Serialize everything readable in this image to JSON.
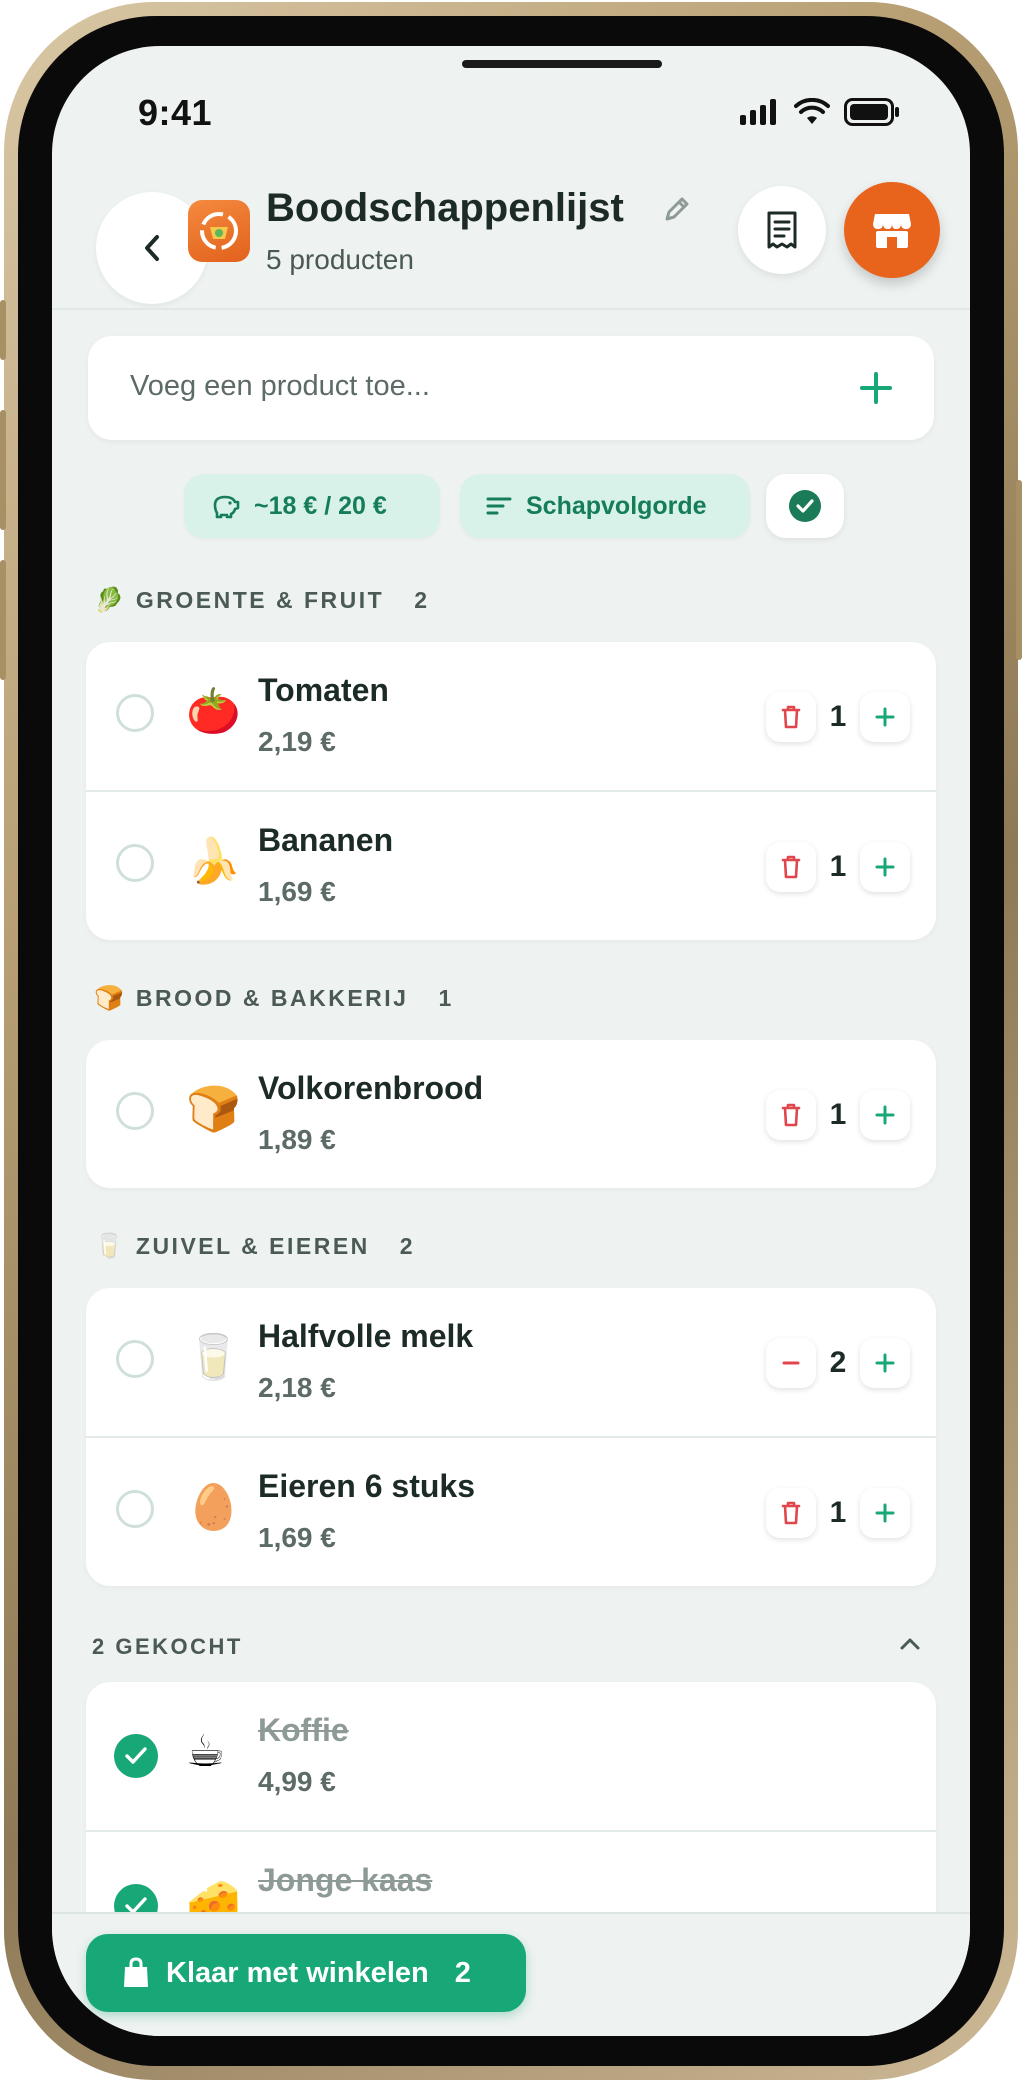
{
  "status_bar": {
    "time": "9:41"
  },
  "header": {
    "title": "Boodschappenlijst",
    "subtitle": "5 producten"
  },
  "add_product": {
    "placeholder": "Voeg een product toe..."
  },
  "chips": {
    "budget": "~18 € / 20 €",
    "sort": "Schapvolgorde"
  },
  "sections": [
    {
      "emoji": "🥬",
      "title": "GROENTE & FRUIT",
      "count": "2",
      "items": [
        {
          "emoji": "🍅",
          "name": "Tomaten",
          "price": "2,19 €",
          "qty": "1",
          "minus_icon": "trash-icon"
        },
        {
          "emoji": "🍌",
          "name": "Bananen",
          "price": "1,69 €",
          "qty": "1",
          "minus_icon": "trash-icon"
        }
      ]
    },
    {
      "emoji": "🍞",
      "title": "BROOD & BAKKERIJ",
      "count": "1",
      "items": [
        {
          "emoji": "🍞",
          "name": "Volkorenbrood",
          "price": "1,89 €",
          "qty": "1",
          "minus_icon": "trash-icon"
        }
      ]
    },
    {
      "emoji": "🥛",
      "title": "ZUIVEL & EIEREN",
      "count": "2",
      "items": [
        {
          "emoji": "🥛",
          "name": "Halfvolle melk",
          "price": "2,18 €",
          "qty": "2",
          "minus_icon": "minus-icon"
        },
        {
          "emoji": "🥚",
          "name": "Eieren 6 stuks",
          "price": "1,69 €",
          "qty": "1",
          "minus_icon": "trash-icon"
        }
      ]
    }
  ],
  "bought": {
    "title": "2 GEKOCHT",
    "items": [
      {
        "emoji": "☕",
        "name": "Koffie",
        "price": "4,99 €"
      },
      {
        "emoji": "🧀",
        "name": "Jonge kaas",
        "price": ""
      }
    ]
  },
  "done_button": {
    "label": "Klaar met winkelen",
    "count": "2"
  },
  "colors": {
    "accent_green": "#18a777",
    "brand_orange": "#e8641c",
    "danger_red": "#e0464b",
    "chip_bg": "#d8f2e9",
    "screen_bg": "#eef2f0"
  }
}
